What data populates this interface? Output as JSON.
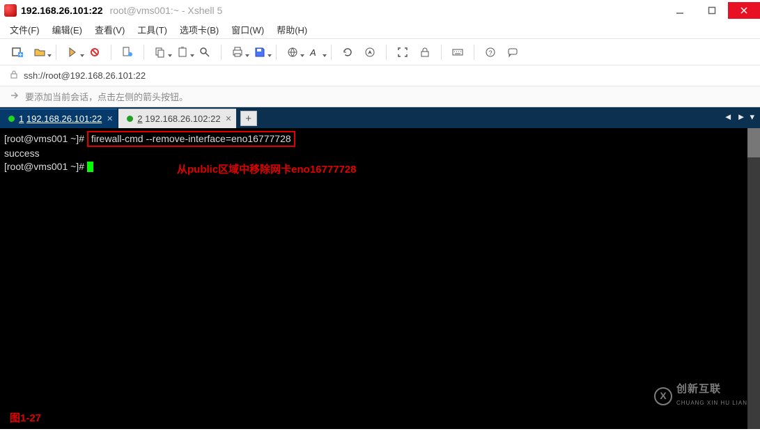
{
  "title": {
    "host": "192.168.26.101:22",
    "sub": "root@vms001:~ - Xshell 5"
  },
  "menu": {
    "file": "文件(F)",
    "edit": "编辑(E)",
    "view": "查看(V)",
    "tools": "工具(T)",
    "tabs": "选项卡(B)",
    "window": "窗口(W)",
    "help": "帮助(H)"
  },
  "address": {
    "url": "ssh://root@192.168.26.101:22"
  },
  "hint": {
    "text": "要添加当前会话，点击左侧的箭头按钮。"
  },
  "tabs": [
    {
      "n": "1",
      "label": "192.168.26.101:22",
      "active": true
    },
    {
      "n": "2",
      "label": "192.168.26.102:22",
      "active": false
    }
  ],
  "terminal": {
    "prompt": "[root@vms001 ~]#",
    "cmd": "firewall-cmd --remove-interface=eno16777728",
    "out": "success",
    "caption": "从public区域中移除网卡eno16777728",
    "figure": "图1-27"
  },
  "watermark": {
    "zh": "创新互联",
    "en": "CHUANG XIN HU LIAN",
    "mark": "X"
  },
  "addtab": "+"
}
